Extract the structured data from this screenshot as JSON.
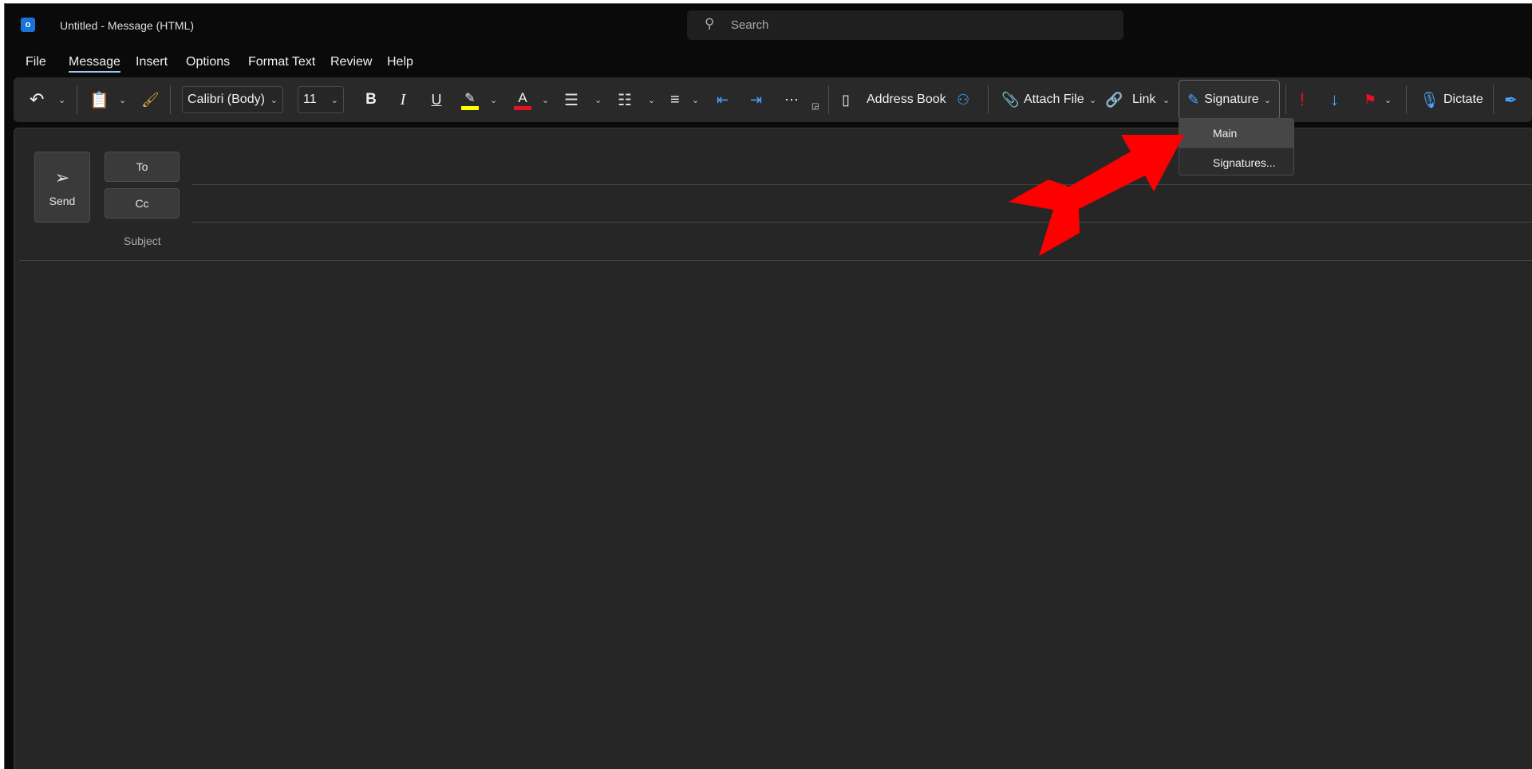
{
  "window": {
    "title": "Untitled  -  Message (HTML)",
    "search_placeholder": "Search"
  },
  "menu": [
    "File",
    "Message",
    "Insert",
    "Options",
    "Format Text",
    "Review",
    "Help"
  ],
  "ribbon": {
    "font": "Calibri (Body)",
    "size": "11",
    "bold": "B",
    "italic": "I",
    "underline": "U",
    "font_color_letter": "A",
    "address_book": "Address Book",
    "attach_file": "Attach File",
    "link": "Link",
    "signature": "Signature",
    "dictate": "Dictate"
  },
  "signature_menu": [
    "Main",
    "Signatures..."
  ],
  "compose": {
    "send": "Send",
    "to": "To",
    "cc": "Cc",
    "subject": "Subject"
  },
  "colors": {
    "highlight": "#ffff00",
    "font_color": "#e81123",
    "arrow": "#ff0000",
    "accent": "#4aa3ff"
  }
}
